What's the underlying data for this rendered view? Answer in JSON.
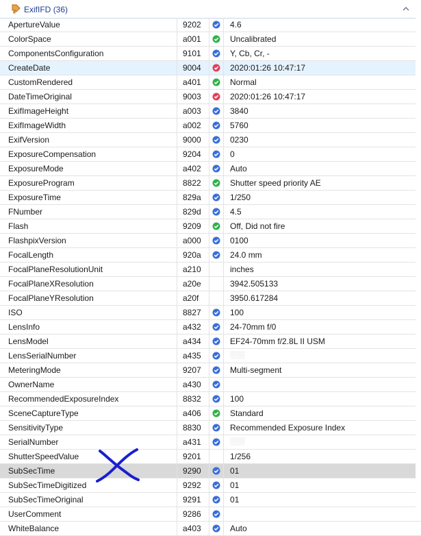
{
  "group": {
    "title": "ExifIFD",
    "count": "(36)",
    "header_icon": "tag-icon",
    "collapse_icon": "chevron-up-icon"
  },
  "status_colors": {
    "blue": "#3a6fd8",
    "green": "#2fb24a",
    "red": "#e0405a"
  },
  "rows": [
    {
      "name": "ApertureValue",
      "tag": "9202",
      "status": "blue",
      "value": "4.6"
    },
    {
      "name": "ColorSpace",
      "tag": "a001",
      "status": "green",
      "value": "Uncalibrated"
    },
    {
      "name": "ComponentsConfiguration",
      "tag": "9101",
      "status": "blue",
      "value": "Y, Cb, Cr, -"
    },
    {
      "name": "CreateDate",
      "tag": "9004",
      "status": "red",
      "value": "2020:01:26 10:47:17",
      "selected": true
    },
    {
      "name": "CustomRendered",
      "tag": "a401",
      "status": "green",
      "value": "Normal"
    },
    {
      "name": "DateTimeOriginal",
      "tag": "9003",
      "status": "red",
      "value": "2020:01:26 10:47:17"
    },
    {
      "name": "ExifImageHeight",
      "tag": "a003",
      "status": "blue",
      "value": "3840"
    },
    {
      "name": "ExifImageWidth",
      "tag": "a002",
      "status": "blue",
      "value": "5760"
    },
    {
      "name": "ExifVersion",
      "tag": "9000",
      "status": "blue",
      "value": "0230"
    },
    {
      "name": "ExposureCompensation",
      "tag": "9204",
      "status": "blue",
      "value": "0"
    },
    {
      "name": "ExposureMode",
      "tag": "a402",
      "status": "blue",
      "value": "Auto"
    },
    {
      "name": "ExposureProgram",
      "tag": "8822",
      "status": "green",
      "value": "Shutter speed priority AE"
    },
    {
      "name": "ExposureTime",
      "tag": "829a",
      "status": "blue",
      "value": "1/250"
    },
    {
      "name": "FNumber",
      "tag": "829d",
      "status": "blue",
      "value": "4.5"
    },
    {
      "name": "Flash",
      "tag": "9209",
      "status": "green",
      "value": "Off, Did not fire"
    },
    {
      "name": "FlashpixVersion",
      "tag": "a000",
      "status": "blue",
      "value": "0100"
    },
    {
      "name": "FocalLength",
      "tag": "920a",
      "status": "blue",
      "value": "24.0 mm"
    },
    {
      "name": "FocalPlaneResolutionUnit",
      "tag": "a210",
      "status": "",
      "value": "inches"
    },
    {
      "name": "FocalPlaneXResolution",
      "tag": "a20e",
      "status": "",
      "value": "3942.505133"
    },
    {
      "name": "FocalPlaneYResolution",
      "tag": "a20f",
      "status": "",
      "value": "3950.617284"
    },
    {
      "name": "ISO",
      "tag": "8827",
      "status": "blue",
      "value": "100"
    },
    {
      "name": "LensInfo",
      "tag": "a432",
      "status": "blue",
      "value": "24-70mm f/0"
    },
    {
      "name": "LensModel",
      "tag": "a434",
      "status": "blue",
      "value": "EF24-70mm f/2.8L II USM"
    },
    {
      "name": "LensSerialNumber",
      "tag": "a435",
      "status": "blue",
      "value": "",
      "blurred": true
    },
    {
      "name": "MeteringMode",
      "tag": "9207",
      "status": "blue",
      "value": "Multi-segment"
    },
    {
      "name": "OwnerName",
      "tag": "a430",
      "status": "blue",
      "value": ""
    },
    {
      "name": "RecommendedExposureIndex",
      "tag": "8832",
      "status": "blue",
      "value": "100"
    },
    {
      "name": "SceneCaptureType",
      "tag": "a406",
      "status": "green",
      "value": "Standard"
    },
    {
      "name": "SensitivityType",
      "tag": "8830",
      "status": "blue",
      "value": "Recommended Exposure Index"
    },
    {
      "name": "SerialNumber",
      "tag": "a431",
      "status": "blue",
      "value": "",
      "blurred": true
    },
    {
      "name": "ShutterSpeedValue",
      "tag": "9201",
      "status": "",
      "value": "1/256"
    },
    {
      "name": "SubSecTime",
      "tag": "9290",
      "status": "blue",
      "value": "01",
      "focused": true
    },
    {
      "name": "SubSecTimeDigitized",
      "tag": "9292",
      "status": "blue",
      "value": "01"
    },
    {
      "name": "SubSecTimeOriginal",
      "tag": "9291",
      "status": "blue",
      "value": "01"
    },
    {
      "name": "UserComment",
      "tag": "9286",
      "status": "blue",
      "value": ""
    },
    {
      "name": "WhiteBalance",
      "tag": "a403",
      "status": "blue",
      "value": "Auto"
    }
  ]
}
